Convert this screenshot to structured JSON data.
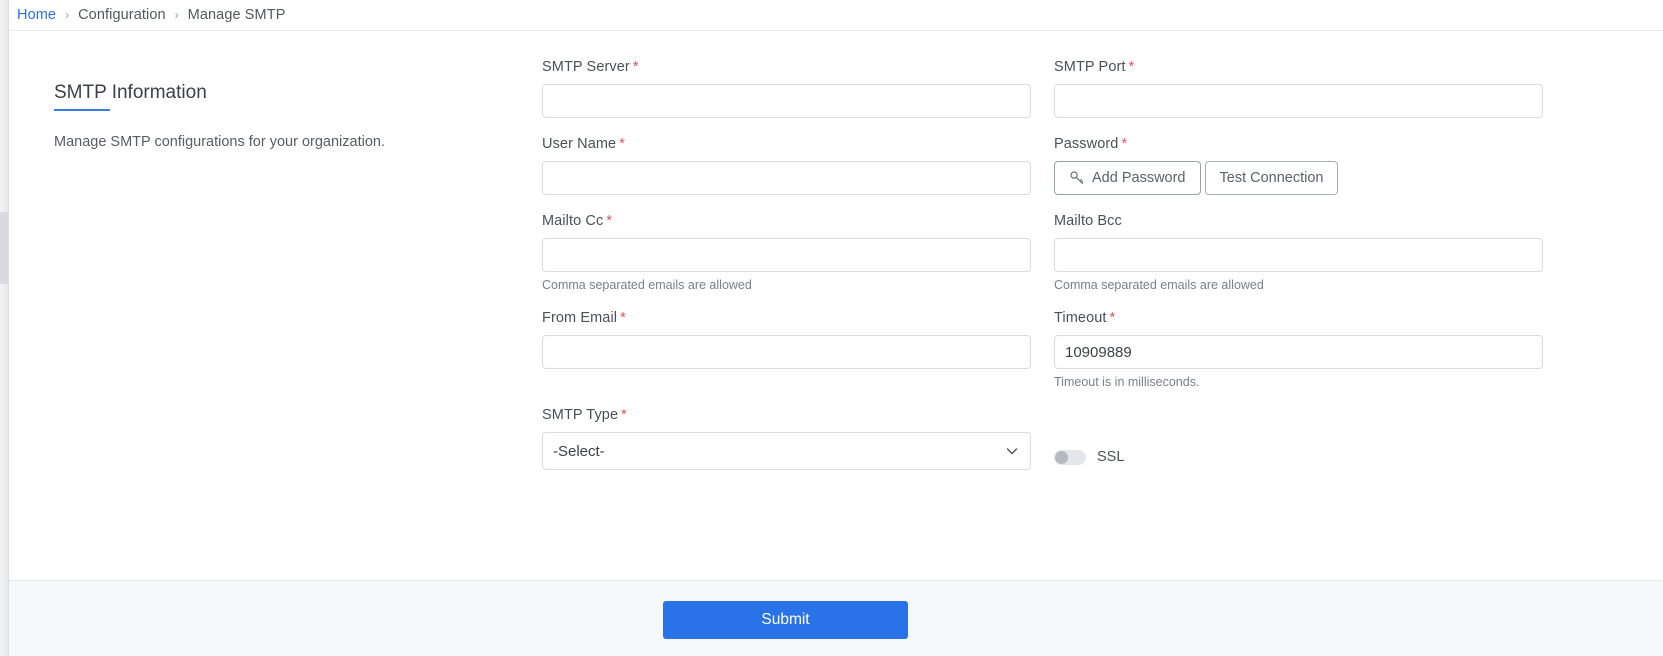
{
  "breadcrumb": {
    "items": [
      {
        "label": "Home",
        "type": "link"
      },
      {
        "label": "Configuration",
        "type": "text"
      },
      {
        "label": "Manage SMTP",
        "type": "current"
      }
    ],
    "separator": "›"
  },
  "section": {
    "title": "SMTP Information",
    "subtitle": "Manage SMTP configurations for your organization.",
    "underline_color": "#3b7ddd"
  },
  "form": {
    "required_marker": "*",
    "smtp_server": {
      "label": "SMTP Server",
      "required": true,
      "value": "",
      "placeholder": ""
    },
    "smtp_port": {
      "label": "SMTP Port",
      "required": true,
      "value": "",
      "placeholder": ""
    },
    "user_name": {
      "label": "User Name",
      "required": true,
      "value": "",
      "placeholder": ""
    },
    "password": {
      "label": "Password",
      "required": true,
      "add_password_label": "Add Password",
      "add_password_icon": "key-icon",
      "test_connection_label": "Test Connection"
    },
    "mailto_cc": {
      "label": "Mailto Cc",
      "required": true,
      "value": "",
      "placeholder": "",
      "help": "Comma separated emails are allowed"
    },
    "mailto_bcc": {
      "label": "Mailto Bcc",
      "required": false,
      "value": "",
      "placeholder": "",
      "help": "Comma separated emails are allowed"
    },
    "from_email": {
      "label": "From Email",
      "required": true,
      "value": "",
      "placeholder": ""
    },
    "timeout": {
      "label": "Timeout",
      "required": true,
      "value": "10909889",
      "placeholder": "",
      "help": "Timeout is in milliseconds."
    },
    "smtp_type": {
      "label": "SMTP Type",
      "required": true,
      "selected": "-Select-",
      "options": [
        "-Select-"
      ],
      "chevron_icon": "chevron-down-icon"
    },
    "ssl": {
      "label": "SSL",
      "enabled": false
    }
  },
  "footer": {
    "submit_label": "Submit",
    "submit_color": "#2a72e8"
  }
}
